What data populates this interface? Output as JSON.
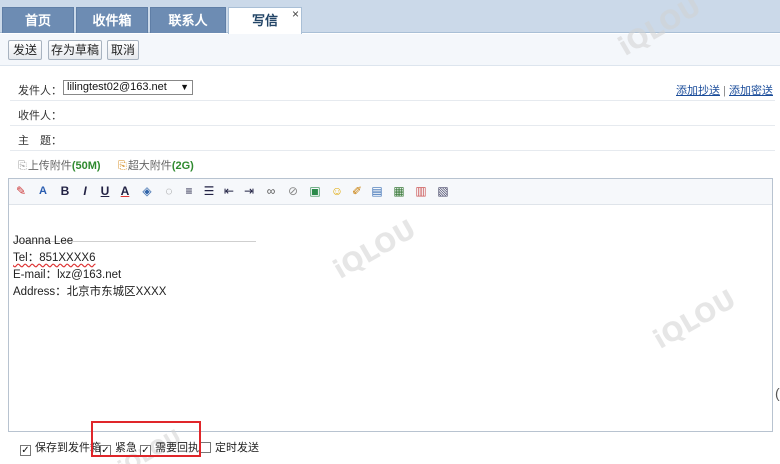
{
  "tabs": [
    {
      "label": "首页"
    },
    {
      "label": "收件箱"
    },
    {
      "label": "联系人"
    },
    {
      "label": "写信"
    }
  ],
  "tab_close": "×",
  "toolbar": {
    "send_label": "发送",
    "draft_label": "存为草稿",
    "cancel_label": "取消"
  },
  "form": {
    "from_label": "发件人：",
    "from_value": "lilingtest02@163.net",
    "to_label": "收件人：",
    "subject_label": "主　题：",
    "add_cc": "添加抄送",
    "separator": "|",
    "add_bcc": "添加密送",
    "upload_attachment": "上传附件",
    "upload_limit": "(50M)",
    "large_attachment": "超大附件",
    "large_limit": "(2G)"
  },
  "editor": {
    "signature": [
      "Joanna Lee",
      "Tel：851XXXX6",
      "E-mail：lxz@163.net",
      "Address：北京市东城区XXXX"
    ]
  },
  "footer": {
    "save_to_sent": "保存到发件箱",
    "urgent": "紧急",
    "receipt": "需要回执",
    "scheduled": "定时发送",
    "save_checked": true,
    "urgent_checked": true,
    "receipt_checked": true,
    "scheduled_checked": false
  },
  "watermark_text": "iQLOU",
  "colors": {
    "tab_active": "#ffffff",
    "tab_inactive": "#6d8cb3",
    "highlight": "#e0262a",
    "link": "#1a4c9a",
    "size_limit": "#2f8a2f"
  }
}
